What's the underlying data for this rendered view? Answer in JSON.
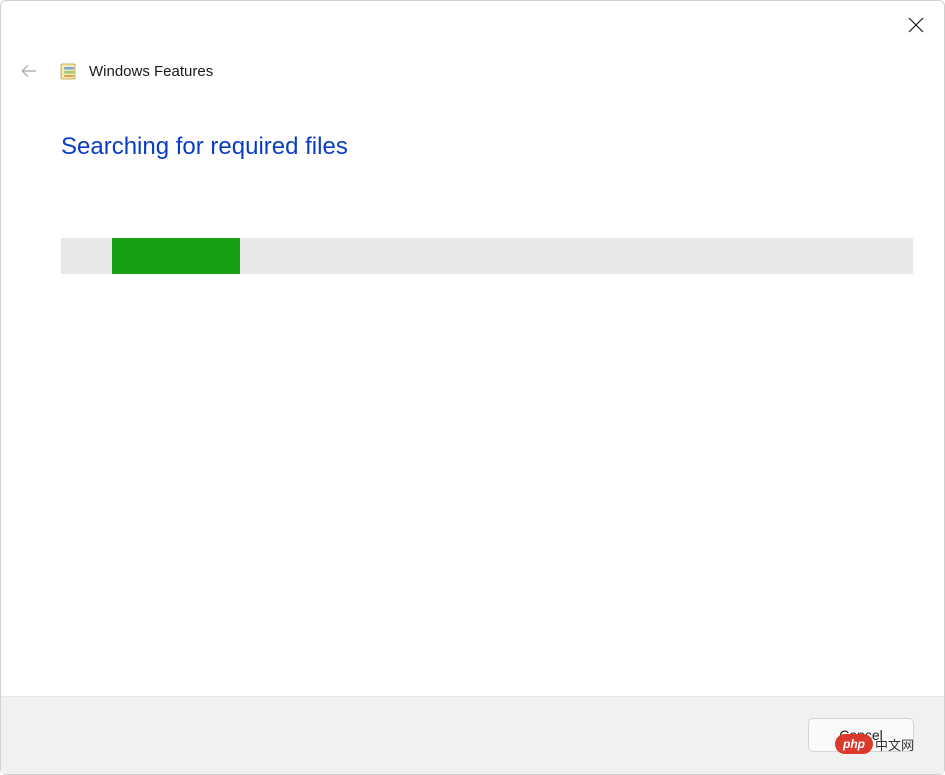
{
  "window": {
    "title": "Windows Features",
    "close_label": "Close",
    "back_label": "Back"
  },
  "status": {
    "heading": "Searching for required files"
  },
  "progress": {
    "offset_percent": 6,
    "width_percent": 15,
    "color": "#15a015",
    "track_color": "#e8e8e8"
  },
  "footer": {
    "cancel_label": "Cancel"
  },
  "watermark": {
    "pill": "php",
    "text": "中文网"
  },
  "colors": {
    "heading": "#0a3ec2",
    "footer_bg": "#f1f1f1"
  }
}
